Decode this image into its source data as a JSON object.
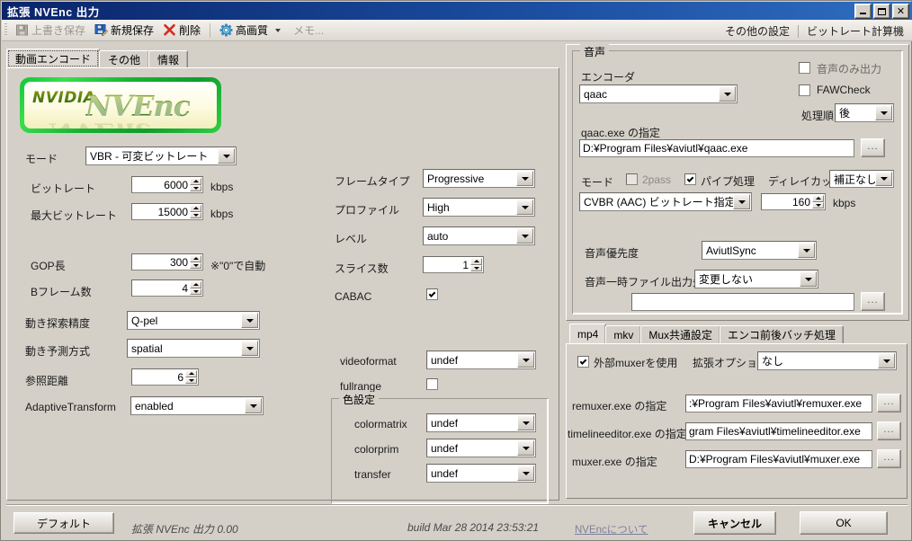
{
  "window": {
    "title": "拡張 NVEnc 出力",
    "minimize_label": "minimize",
    "maximize_label": "maximize",
    "close_label": "✕"
  },
  "toolbar": {
    "overwrite_save": "上書き保存",
    "new_save": "新規保存",
    "delete": "削除",
    "quality_preset": "高画質",
    "memo": "メモ...",
    "other_settings": "その他の設定",
    "bitrate_calculator": "ビットレート計算機"
  },
  "tabs": [
    {
      "label": "動画エンコード",
      "active": true
    },
    {
      "label": "その他",
      "active": false
    },
    {
      "label": "情報",
      "active": false
    }
  ],
  "logo": {
    "brand": "NVIDIA",
    "product": "NVEnc"
  },
  "video": {
    "mode_label": "モード",
    "mode_value": "VBR - 可変ビットレート",
    "bitrate_label": "ビットレート",
    "bitrate_value": "6000",
    "bitrate_unit": "kbps",
    "maxbitrate_label": "最大ビットレート",
    "maxbitrate_value": "15000",
    "maxbitrate_unit": "kbps",
    "gop_label": "GOP長",
    "gop_value": "300",
    "gop_note": "※\"0\"で自動",
    "bframes_label": "Bフレーム数",
    "bframes_value": "4",
    "mesearch_label": "動き探索精度",
    "mesearch_value": "Q-pel",
    "mepredict_label": "動き予測方式",
    "mepredict_value": "spatial",
    "refdist_label": "参照距離",
    "refdist_value": "6",
    "adaptive_label": "AdaptiveTransform",
    "adaptive_value": "enabled"
  },
  "frame": {
    "frametype_label": "フレームタイプ",
    "frametype_value": "Progressive",
    "profile_label": "プロファイル",
    "profile_value": "High",
    "level_label": "レベル",
    "level_value": "auto",
    "slices_label": "スライス数",
    "slices_value": "1",
    "cabac_label": "CABAC",
    "cabac_checked": true,
    "videoformat_label": "videoformat",
    "videoformat_value": "undef",
    "fullrange_label": "fullrange",
    "fullrange_checked": false,
    "color_group_title": "色設定",
    "colormatrix_label": "colormatrix",
    "colormatrix_value": "undef",
    "colorprim_label": "colorprim",
    "colorprim_value": "undef",
    "transfer_label": "transfer",
    "transfer_value": "undef"
  },
  "audio": {
    "group_title": "音声",
    "encoder_label": "エンコーダ",
    "encoder_value": "qaac",
    "audio_only_label": "音声のみ出力",
    "audio_only_checked": false,
    "fawcheck_label": "FAWCheck",
    "fawcheck_checked": false,
    "order_label": "処理順",
    "order_value": "後",
    "exe_path_label": "qaac.exe の指定",
    "exe_path_value": "D:¥Program Files¥aviutl¥qaac.exe",
    "browse_label": "...",
    "mode_label": "モード",
    "twopass_label": "2pass",
    "twopass_checked": false,
    "pipe_label": "パイプ処理",
    "pipe_checked": true,
    "delaycut_label": "ディレイカット",
    "delaycut_value": "補正なし",
    "enc_mode_value": "CVBR (AAC) ビットレート指定",
    "enc_bitrate_value": "160",
    "enc_bitrate_unit": "kbps",
    "priority_label": "音声優先度",
    "priority_value": "AviutlSync",
    "temp_label": "音声一時ファイル出力先",
    "temp_value": "変更しない",
    "temp_path_value": ""
  },
  "mux": {
    "tabs": [
      {
        "label": "mp4",
        "active": true
      },
      {
        "label": "mkv",
        "active": false
      },
      {
        "label": "Mux共通設定",
        "active": false
      },
      {
        "label": "エンコ前後バッチ処理",
        "active": false
      }
    ],
    "use_external_label": "外部muxerを使用",
    "use_external_checked": true,
    "ext_option_label": "拡張オプション",
    "ext_option_value": "なし",
    "browse_label": "...",
    "paths": [
      {
        "label": "remuxer.exe の指定",
        "value": ":¥Program Files¥aviutl¥remuxer.exe"
      },
      {
        "label": "timelineeditor.exe の指定",
        "value": "gram Files¥aviutl¥timelineeditor.exe"
      },
      {
        "label": "muxer.exe の指定",
        "value": "D:¥Program Files¥aviutl¥muxer.exe"
      }
    ]
  },
  "footer": {
    "default_button": "デフォルト",
    "version_text": "拡張 NVEnc 出力 0.00",
    "build_text": "build Mar 28 2014 23:53:21",
    "about_link": "NVEncについて",
    "cancel_button": "キャンセル",
    "ok_button": "OK"
  }
}
